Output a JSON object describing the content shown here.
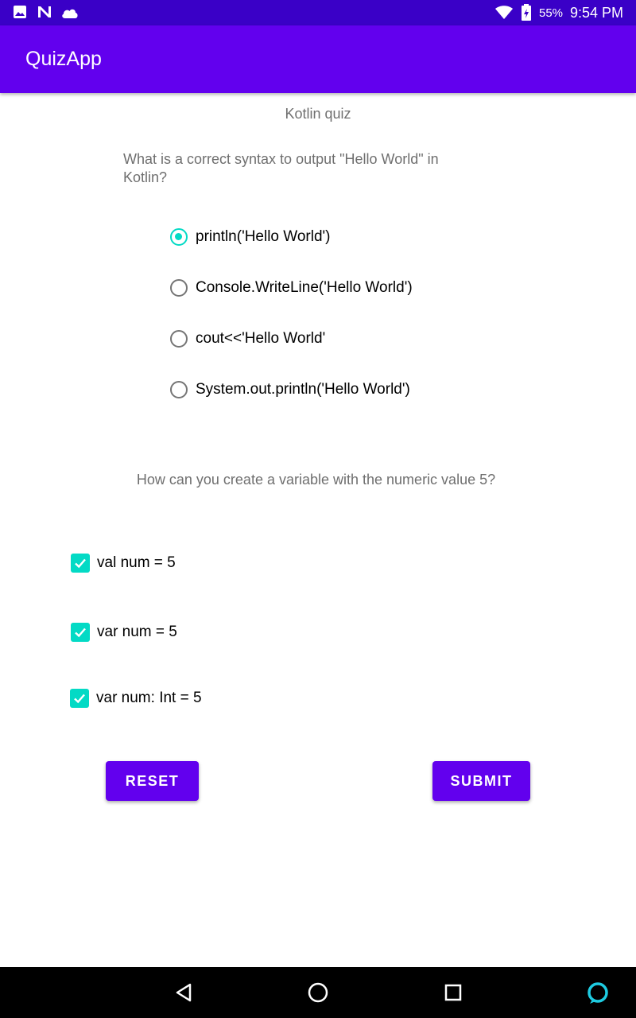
{
  "status_bar": {
    "battery": "55%",
    "time": "9:54 PM",
    "left_icons": [
      "image-icon",
      "n-app-icon",
      "cloud-icon"
    ],
    "right_icons": [
      "wifi-icon",
      "battery-icon"
    ]
  },
  "app_bar": {
    "title": "QuizApp"
  },
  "quiz": {
    "title": "Kotlin quiz",
    "question1": {
      "text": "What is a correct syntax to output \"Hello World\" in Kotlin?",
      "options": [
        {
          "label": "println('Hello World')",
          "checked": true
        },
        {
          "label": "Console.WriteLine('Hello World')",
          "checked": false
        },
        {
          "label": "cout<<'Hello World'",
          "checked": false
        },
        {
          "label": "System.out.println('Hello World')",
          "checked": false
        }
      ]
    },
    "question2": {
      "text": "How can you create a variable with the numeric value 5?",
      "options": [
        {
          "label": "val num = 5",
          "checked": true
        },
        {
          "label": "var num = 5",
          "checked": true
        },
        {
          "label": "var num: Int = 5",
          "checked": true
        }
      ]
    }
  },
  "buttons": {
    "reset": "RESET",
    "submit": "SUBMIT"
  },
  "nav_bar": {
    "icons": [
      "back-icon",
      "home-icon",
      "recents-icon",
      "assistant-icon"
    ]
  },
  "colors": {
    "status_bar": "#3A00C7",
    "primary": "#6200EE",
    "accent": "#03DAC5"
  }
}
